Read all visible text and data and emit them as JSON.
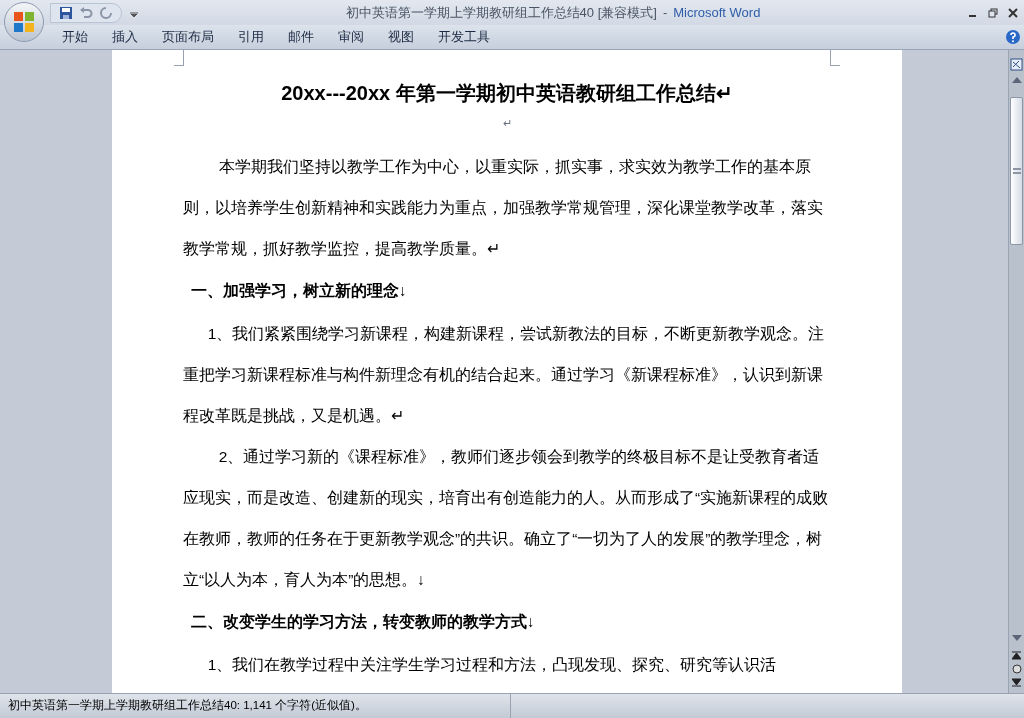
{
  "window": {
    "title": "初中英语第一学期上学期教研组工作总结40 [兼容模式]",
    "separator": "-",
    "app": "Microsoft Word"
  },
  "tabs": [
    "开始",
    "插入",
    "页面布局",
    "引用",
    "邮件",
    "审阅",
    "视图",
    "开发工具"
  ],
  "document": {
    "title": "20xx---20xx 年第一学期初中英语教研组工作总结↵",
    "paragraphs": [
      {
        "kind": "mark",
        "text": "↵"
      },
      {
        "kind": "body",
        "text": "本学期我们坚持以教学工作为中心，以重实际，抓实事，求实效为教学工作的基本原则，以培养学生创新精神和实践能力为重点，加强教学常规管理，深化课堂教学改革，落实教学常规，抓好教学监控，提高教学质量。↵"
      },
      {
        "kind": "heading",
        "text": "一、加强学习，树立新的理念↓"
      },
      {
        "kind": "item",
        "text": "1、我们紧紧围绕学习新课程，构建新课程，尝试新教法的目标，不断更新教学观念。注重把学习新课程标准与构件新理念有机的结合起来。通过学习《新课程标准》，认识到新课程改革既是挑战，又是机遇。↵"
      },
      {
        "kind": "body",
        "text": "2、通过学习新的《课程标准》，教师们逐步领会到教学的终极目标不是让受教育者适应现实，而是改造、创建新的现实，培育出有创造能力的人。从而形成了“实施新课程的成败在教师，教师的任务在于更新教学观念”的共识。确立了“一切为了人的发展”的教学理念，树立“以人为本，育人为本”的思想。↓"
      },
      {
        "kind": "heading",
        "text": "二、改变学生的学习方法，转变教师的教学方式↓"
      },
      {
        "kind": "item",
        "text": "1、我们在教学过程中关注学生学习过程和方法，凸现发现、探究、研究等认识活"
      }
    ]
  },
  "status_bar": "初中英语第一学期上学期教研组工作总结40: 1,141 个字符(近似值)。"
}
